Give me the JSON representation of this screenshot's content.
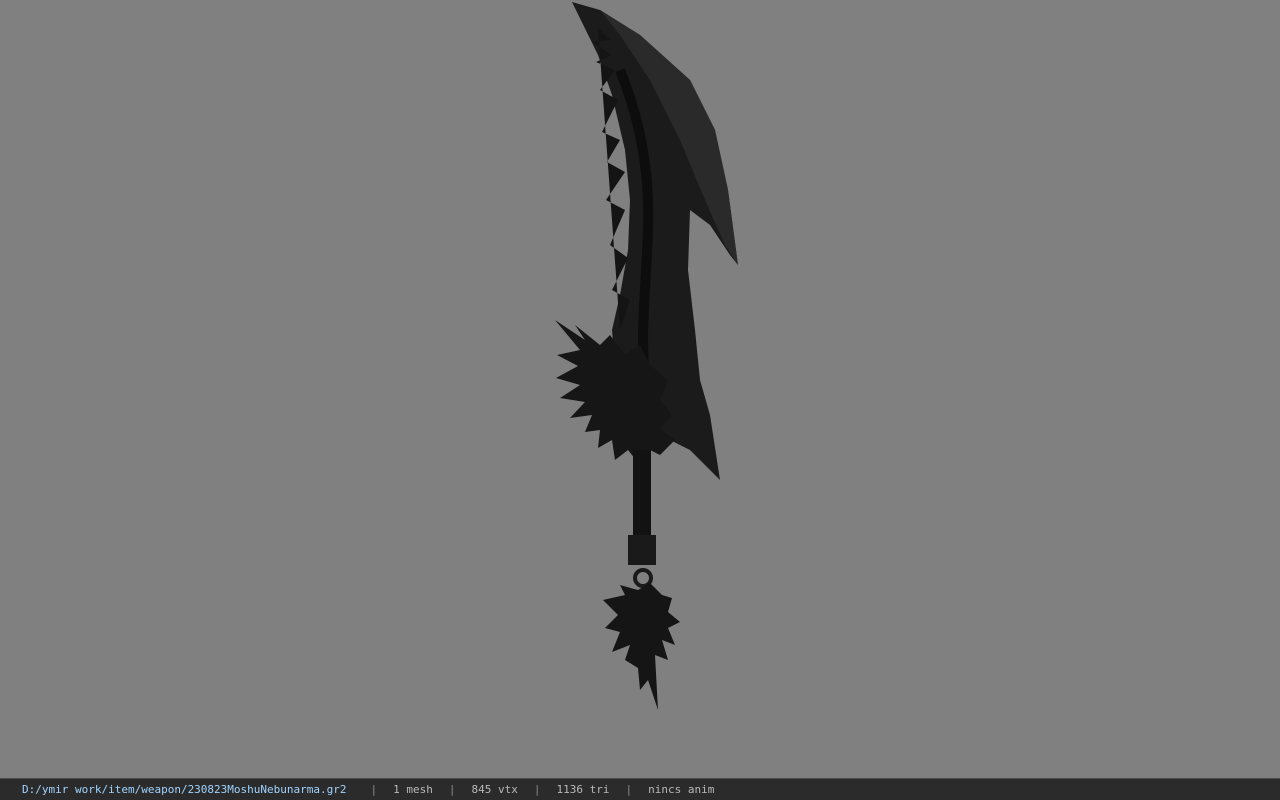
{
  "viewport": {
    "background_color": "#808080",
    "model": {
      "kind": "3d-weapon-model",
      "color": "#1a1a1a"
    }
  },
  "status_bar": {
    "file_path": "D:/ymir work/item/weapon/230823MoshuNebunarma.gr2",
    "mesh_count": "1 mesh",
    "vertex_count": "845 vtx",
    "triangle_count": "1136 tri",
    "animation": "nincs anim",
    "separator": "|",
    "text_color": "#b8b8b8",
    "path_color": "#9fd3ff"
  }
}
